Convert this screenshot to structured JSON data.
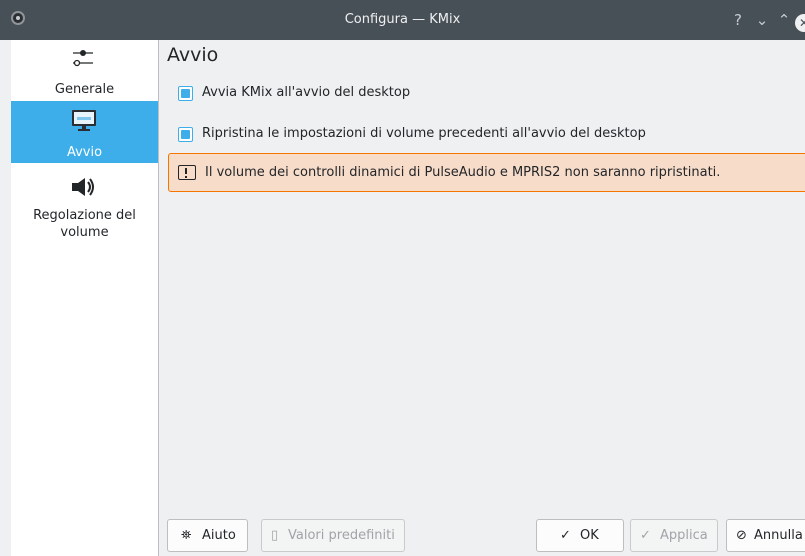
{
  "window": {
    "title": "Configura — KMix",
    "controls": {
      "help": "?",
      "minimize": "⌄",
      "maximize": "⌃",
      "close": "✕"
    }
  },
  "sidebar": {
    "items": [
      {
        "label": "Generale",
        "icon": "sliders-icon",
        "selected": false
      },
      {
        "label": "Avvio",
        "icon": "monitor-icon",
        "selected": true
      },
      {
        "label": "Regolazione del volume",
        "icon": "speaker-icon",
        "selected": false
      }
    ]
  },
  "page": {
    "title": "Avvio",
    "options": [
      {
        "label": "Avvia KMix all'avvio del desktop",
        "checked": true
      },
      {
        "label": "Ripristina le impostazioni di volume precedenti all'avvio del desktop",
        "checked": true
      }
    ],
    "warning": "Il volume dei controlli dinamici di PulseAudio e MPRIS2 non saranno ripristinati."
  },
  "buttons": {
    "help": "Aiuto",
    "defaults": "Valori predefiniti",
    "ok": "OK",
    "apply": "Applica",
    "cancel": "Annulla"
  },
  "colors": {
    "accent": "#3daee9",
    "titlebar": "#475057",
    "warning_border": "#f67400",
    "warning_bg": "#f8dcca"
  }
}
